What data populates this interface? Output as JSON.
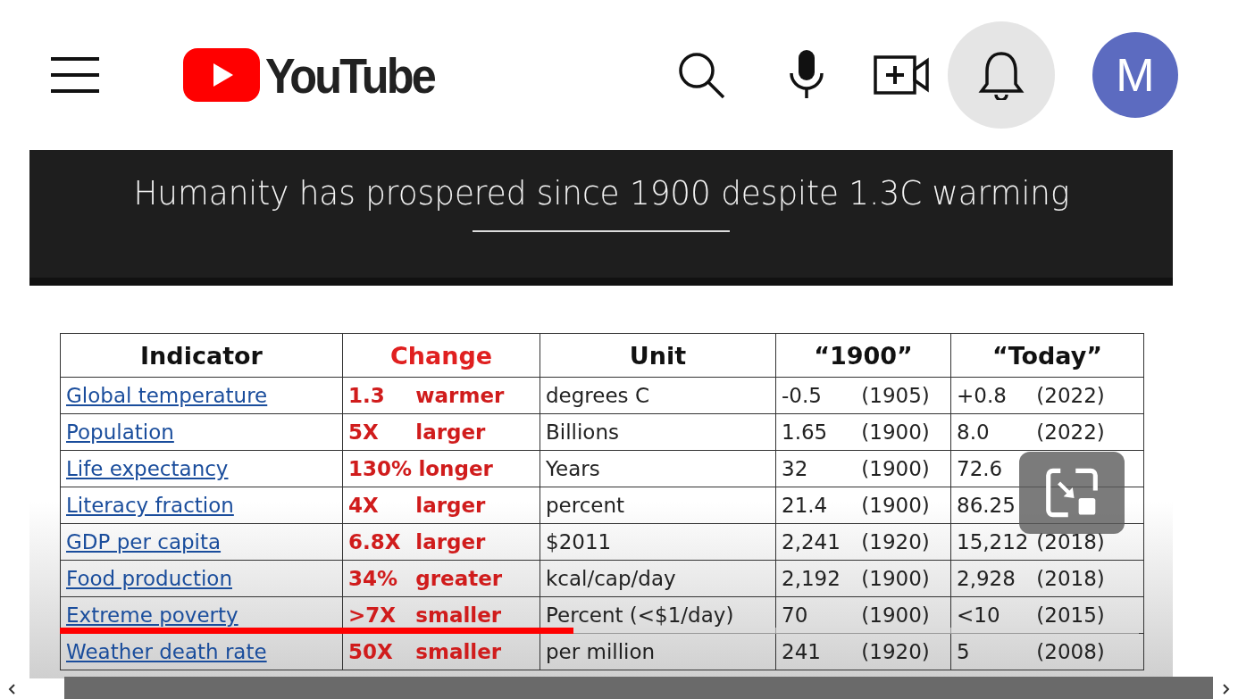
{
  "header": {
    "logo_text": "YouTube",
    "avatar_letter": "M"
  },
  "slide": {
    "title": "Humanity has prospered since 1900 despite 1.3C warming",
    "columns": [
      "Indicator",
      "Change",
      "Unit",
      "“1900”",
      "“Today”"
    ],
    "rows": [
      {
        "indicator": "Global temperature",
        "change_value": "1.3",
        "change_word": "warmer",
        "unit": "degrees C",
        "then_value": "-0.5",
        "then_year": "(1905)",
        "today_value": "+0.8",
        "today_year": "(2022)"
      },
      {
        "indicator": "Population",
        "change_value": "5X",
        "change_word": "larger",
        "unit": "Billions",
        "then_value": "1.65",
        "then_year": "(1900)",
        "today_value": "8.0",
        "today_year": "(2022)"
      },
      {
        "indicator": "Life expectancy",
        "change_value": "130%",
        "change_word": "longer",
        "unit": "Years",
        "then_value": "32",
        "then_year": "(1900)",
        "today_value": "72.6"
      },
      {
        "indicator": "Literacy fraction",
        "change_value": "4X",
        "change_word": "larger",
        "unit": "percent",
        "then_value": "21.4",
        "then_year": "(1900)",
        "today_value": "86.25"
      },
      {
        "indicator": "GDP per capita",
        "change_value": "6.8X",
        "change_word": "larger",
        "unit": "$2011",
        "then_value": "2,241",
        "then_year": "(1920)",
        "today_value": "15,212",
        "today_year": "(2018)"
      },
      {
        "indicator": "Food production",
        "change_value": "34%",
        "change_word": "greater",
        "unit": "kcal/cap/day",
        "then_value": "2,192",
        "then_year": "(1900)",
        "today_value": "2,928",
        "today_year": "(2018)"
      },
      {
        "indicator": "Extreme poverty",
        "change_value": ">7X",
        "change_word": "smaller",
        "unit": "Percent (<$1/day)",
        "then_value": "70",
        "then_year": "(1900)",
        "today_value": "<10",
        "today_year": "(2015)"
      },
      {
        "indicator": "Weather death rate",
        "change_value": "50X",
        "change_word": "smaller",
        "unit": "per million",
        "then_value": "241",
        "then_year": "(1920)",
        "today_value": "5",
        "today_year": "(2008)"
      }
    ]
  },
  "player": {
    "progress": {
      "level": 0.476
    }
  }
}
